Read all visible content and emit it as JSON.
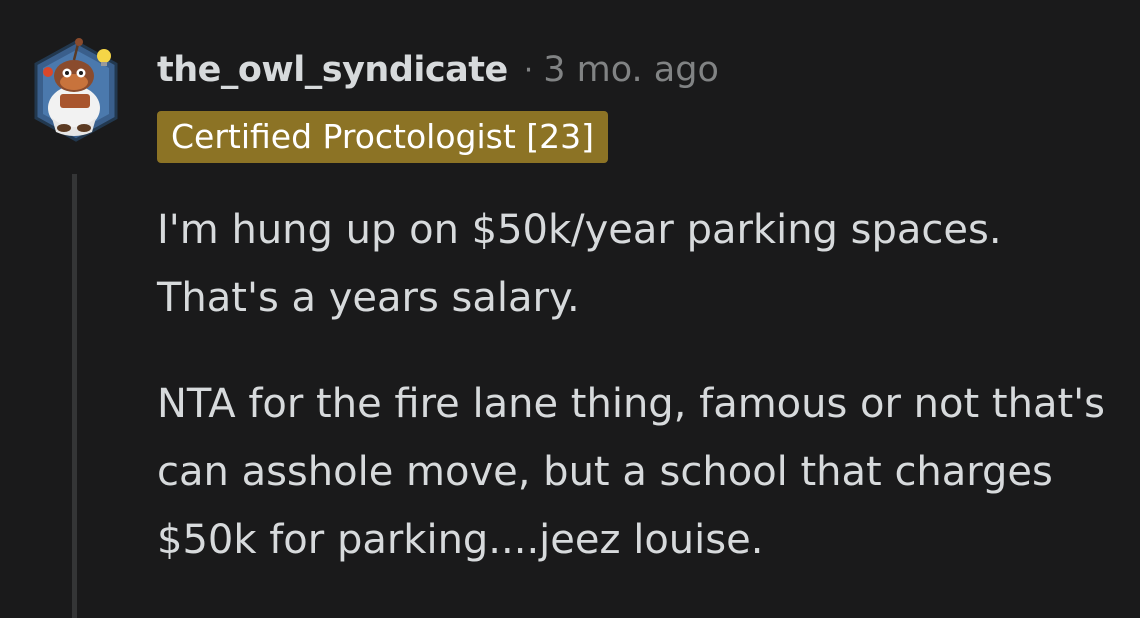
{
  "comment": {
    "username": "the_owl_syndicate",
    "separator": "·",
    "timestamp": "3 mo. ago",
    "flair": "Certified Proctologist [23]",
    "paragraphs": [
      "I'm hung up on $50k/year parking spaces. That's a years salary.",
      "NTA for the fire lane thing, famous or not that's can asshole move, but a school that charges $50k for parking....jeez louise."
    ]
  },
  "colors": {
    "background": "#1a1a1b",
    "text": "#d7dadc",
    "meta": "#818384",
    "flair_bg": "#8c7325",
    "thread_line": "#343536"
  },
  "icons": {
    "avatar": "owl-snoo-avatar-icon"
  }
}
